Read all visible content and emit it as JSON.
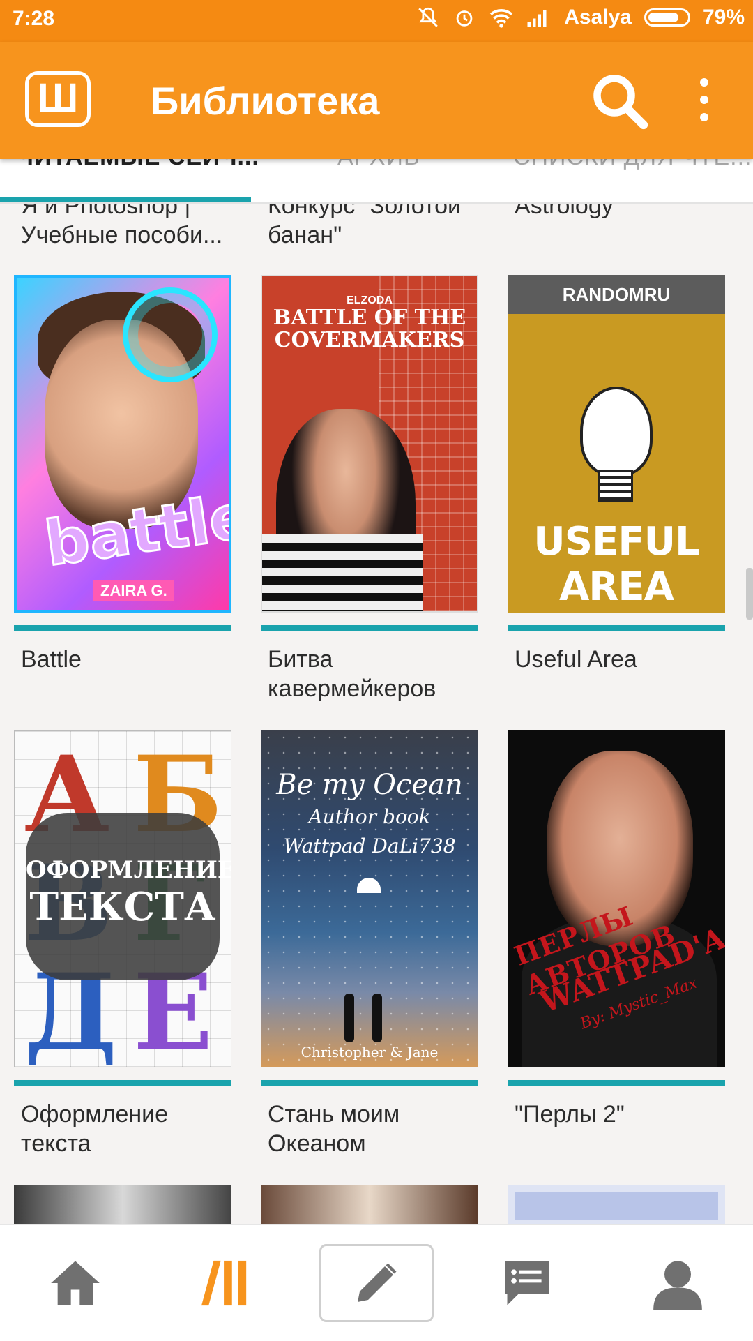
{
  "status_bar": {
    "time": "7:28",
    "carrier": "Asalya",
    "battery_percent": "79%",
    "battery_level": 0.79,
    "icons": [
      "mute-bell-icon",
      "alarm-icon",
      "wifi-icon",
      "signal-icon",
      "battery-icon"
    ]
  },
  "app_bar": {
    "logo_glyph": "Ш",
    "title": "Библиотека",
    "accent": "#f7941d"
  },
  "tabs": {
    "items": [
      {
        "label": "ЧИТАЕМЫЕ СЕЙЧ..."
      },
      {
        "label": "АРХИВ"
      },
      {
        "label": "СПИСКИ ДЛЯ ЧТЕ..."
      }
    ],
    "active_index": 0,
    "indicator_color": "#1aa3ad"
  },
  "partial_top_titles": [
    "Я и Photoshop | Учебные пособи...",
    "Конкурс \"Золотой банан\"",
    "Astrology"
  ],
  "books": [
    {
      "title": "Battle",
      "cover_text": "battle",
      "cover_author": "ZAIRA G."
    },
    {
      "title": "Битва кавермейкеров",
      "cover_top": "ELZODA",
      "cover_head1": "BATTLE OF THE",
      "cover_head2": "COVERMAKERS"
    },
    {
      "title": "Useful Area",
      "cover_band": "RANDOMRU",
      "cover_word": "USEFUL AREA"
    },
    {
      "title": "Оформление текста",
      "cover_letters": [
        "А",
        "Б",
        "В",
        "Г",
        "Д",
        "Е"
      ],
      "cover_l1": "ОФОРМЛЕНИЕ",
      "cover_l2": "ТЕКСТА"
    },
    {
      "title": "Стань моим Океаном",
      "cover_t1": "Be my Ocean",
      "cover_t2": "Author book",
      "cover_t3": "Wattpad DaLi738",
      "cover_t4": "Christopher & Jane"
    },
    {
      "title": "\"Перлы 2\"",
      "cover_r1": "ПЕРЛЫ АВТОРОВ",
      "cover_r2": "WATTPAD'A",
      "cover_r3": "By: Mystic_Max"
    }
  ],
  "bottom_nav": {
    "items": [
      "home-icon",
      "library-icon",
      "write-icon",
      "messages-icon",
      "profile-icon"
    ],
    "active_index": 1
  }
}
